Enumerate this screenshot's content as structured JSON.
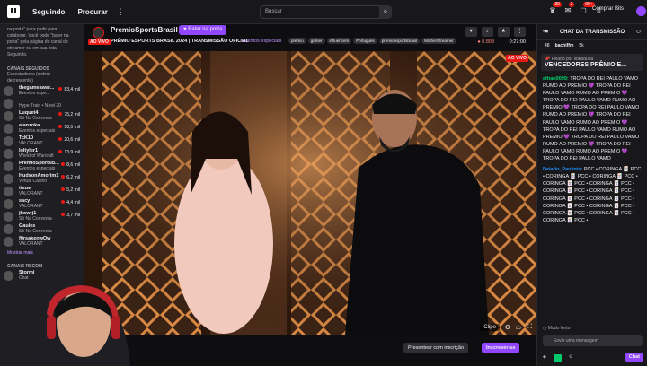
{
  "topbar": {
    "following": "Seguindo",
    "browse": "Procurar",
    "more": "⋮",
    "search_placeholder": "Buscar",
    "badges": [
      "30",
      "2",
      "99+"
    ],
    "bits": "Comprar Bits"
  },
  "sidebar": {
    "message": "na porta\" para pedir para colaborar. Você pode \"bater na porta\" pela página do canal do streamer ou em sua lista Seguindo.",
    "followed_header": "CANAIS SEGUIDOS",
    "followed_sub": "Espectadores (ordem decrescente)",
    "channels": [
      {
        "name": "thegameawar...",
        "game": "Eventos espe...",
        "viewers": "83,4 mil"
      },
      {
        "name": "",
        "game": "Hype Train • Nível 20",
        "viewers": ""
      },
      {
        "name": "Luquet4",
        "game": "Só Na Conversa",
        "viewers": "75,2 mil"
      },
      {
        "name": "alanzoka",
        "game": "Eventos especiais",
        "viewers": "58,5 mil"
      },
      {
        "name": "TcK10",
        "game": "VALORANT",
        "viewers": "20,6 mil"
      },
      {
        "name": "loltyler1",
        "game": "World of Warcraft",
        "viewers": "13,9 mil"
      },
      {
        "name": "PremioSportsB...",
        "game": "Eventos especiais",
        "viewers": "8,6 mil"
      },
      {
        "name": "HudsonAmorim1",
        "game": "Virtual Casino",
        "viewers": "6,2 mil"
      },
      {
        "name": "ttsuw",
        "game": "VALORANT",
        "viewers": "5,2 mil"
      },
      {
        "name": "sacy",
        "game": "VALORANT",
        "viewers": "4,4 mil"
      },
      {
        "name": "jhowrj1",
        "game": "Só Na Conversa",
        "viewers": "3,7 mil"
      },
      {
        "name": "Gaules",
        "game": "Só Na Conversa",
        "viewers": ""
      },
      {
        "name": "f0rsakenwOw",
        "game": "VALORANT",
        "viewers": ""
      }
    ],
    "show_more": "Mostrar mais",
    "recommended_header": "CANAIS RECOM",
    "rec_channel": "Stormi",
    "rec_game": "Chat"
  },
  "stream": {
    "channel": "PremioSportsBrasil",
    "follow_label": "Bater na porta",
    "live": "AO VIVO",
    "title": "PRÊMIO ESPORTS BRASIL 2024 | TRANSMISSÃO OFICIAL",
    "category": "Eventos especiais",
    "tags": [
      "premio",
      "gamer",
      "influencers",
      "Português",
      "premioesportsbrasil",
      "MotherStreamer"
    ],
    "viewers": "8.808",
    "uptime": "0:27:00",
    "clip": "Clipe"
  },
  "below": {
    "present": "Presentear com inscrição",
    "subscribe": "Inscrever-se"
  },
  "chat": {
    "header": "CHAT DA TRANSMISSÃO",
    "leader1": "48",
    "leader_user": "bachiffm",
    "leader2": "5k",
    "pinned_by": "Fixado por",
    "pinned_by_user": "staladuba",
    "pinned_text": "VENCEDORES PRÊMIO E...",
    "messages": [
      {
        "user": "ethan0099:",
        "text": "TROPA DO REI PAULO VAMO RUMO AO PREMIO 💜 TROPA DO REI PAULO VAMO RUMO AO PREMIO 💜 TROPA DO REI PAULO VAMO RUMO AO PREMIO 💜 TROPA DO REI PAULO VAMO RUMO AO PREMIO 💜 TROPA DO REI PAULO VAMO RUMO AO PREMIO 💜 TROPA DO REI PAULO VAMO RUMO AO PREMIO 💜 TROPA DO REI PAULO VAMO RUMO AO PREMIO 💜 TROPA DO REI PAULO VAMO RUMO AO PREMIO 💜 TROPA DO REI PAULO VAMO"
      },
      {
        "user": "Deiado_Paulinis:",
        "text": "PCC • CORINGA 🃏 PCC • CORINGA 🃏 PCC • CORINGA 🃏 PCC • CORINGA 🃏 PCC • CORINGA 🃏 PCC • CORINGA 🃏 PCC • CORINGA 🃏 PCC • CORINGA 🃏 PCC • CORINGA 🃏 PCC • CORINGA 🃏 PCC • CORINGA 🃏 PCC • CORINGA 🃏 PCC • CORINGA 🃏 PCC • CORINGA 🃏 PCC •"
      }
    ],
    "mode": "Modo lento",
    "input_placeholder": "Envie uma mensagem",
    "send": "Chat"
  }
}
